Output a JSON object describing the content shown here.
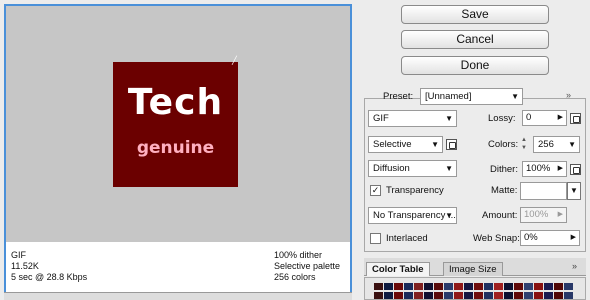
{
  "buttons": {
    "save": "Save",
    "cancel": "Cancel",
    "done": "Done"
  },
  "preview": {
    "logo_main": "Tech",
    "logo_sub": "genuine",
    "info_left": [
      "GIF",
      "11.52K",
      "5 sec @ 28.8 Kbps"
    ],
    "info_right": [
      "100% dither",
      "Selective palette",
      "256 colors"
    ]
  },
  "options": {
    "preset_label": "Preset:",
    "preset_value": "[Unnamed]",
    "format_value": "GIF",
    "reduction_value": "Selective",
    "dither_algo_value": "Diffusion",
    "transparency_label": "Transparency",
    "transparency_checked": true,
    "transparency_dither_value": "No Transparency ...",
    "interlaced_label": "Interlaced",
    "interlaced_checked": false,
    "lossy_label": "Lossy:",
    "lossy_value": "0",
    "colors_label": "Colors:",
    "colors_value": "256",
    "dither_label": "Dither:",
    "dither_value": "100%",
    "matte_label": "Matte:",
    "matte_value": "",
    "amount_label": "Amount:",
    "amount_value": "100%",
    "websnap_label": "Web Snap:",
    "websnap_value": "0%"
  },
  "tabs": {
    "color_table": "Color Table",
    "image_size": "Image Size"
  },
  "colors": {
    "preview_border": "#4a90d9",
    "logo_background": "#6b0000",
    "swatches": [
      "#3a1010",
      "#0e1a40",
      "#6a0808",
      "#1a2a5a",
      "#802020",
      "#101030",
      "#5a0a0a",
      "#2a3a6a",
      "#901818",
      "#151540",
      "#700c0c",
      "#203060",
      "#a02020",
      "#0c1030",
      "#600808",
      "#304070",
      "#881010",
      "#1a1a50",
      "#500606",
      "#283868"
    ]
  }
}
